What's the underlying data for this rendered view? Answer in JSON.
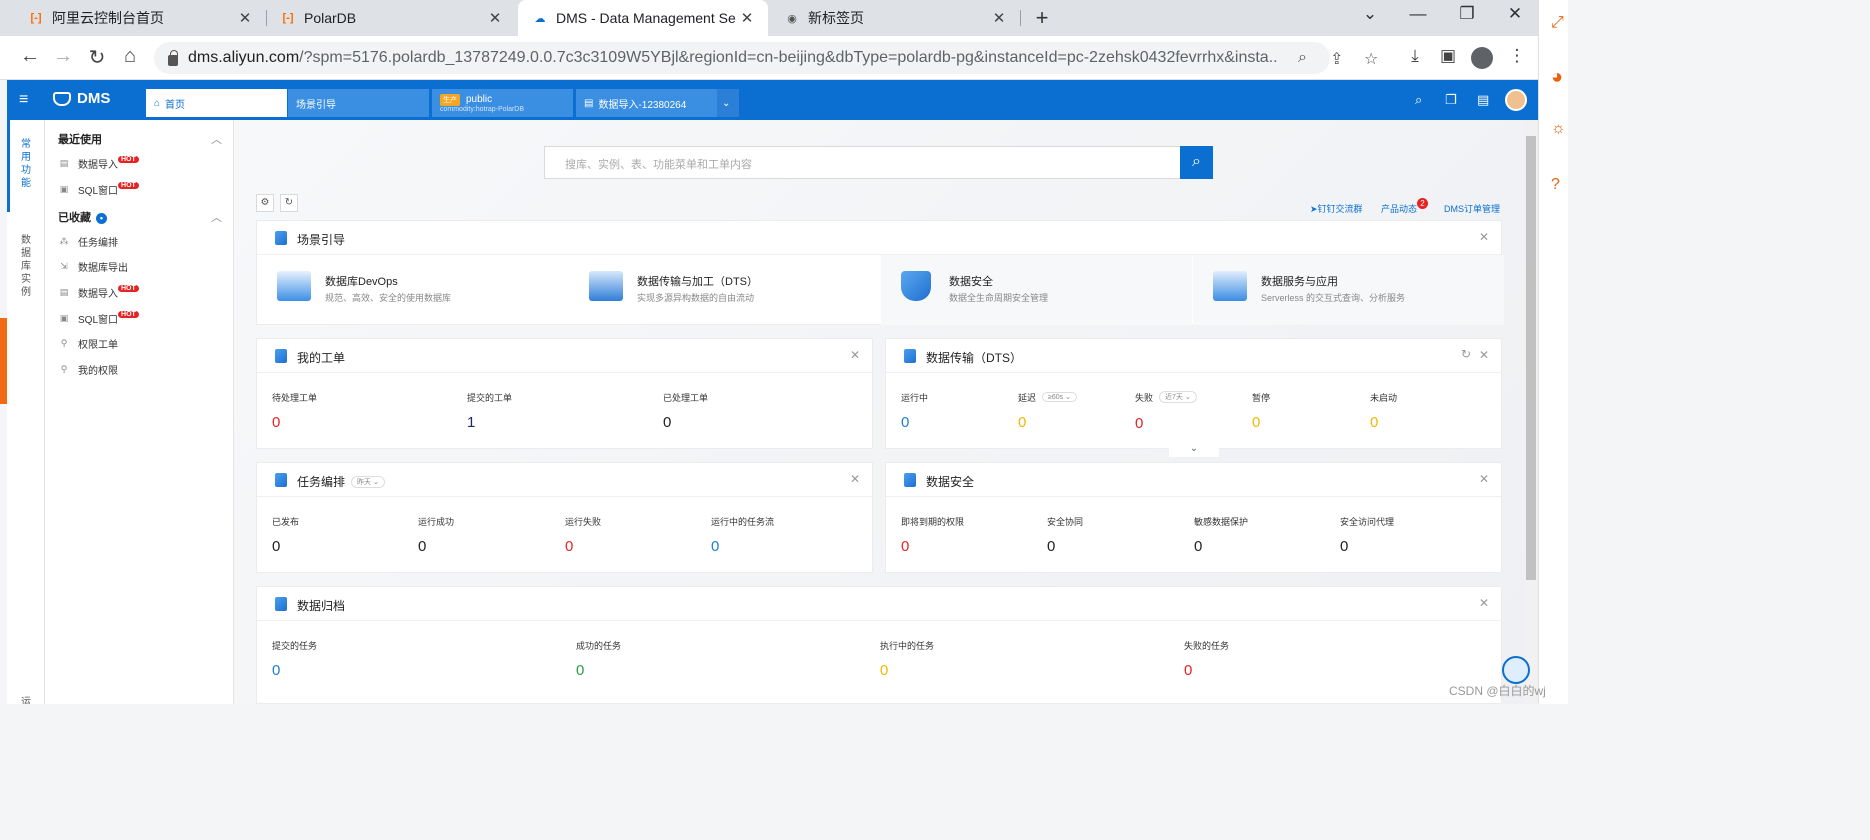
{
  "browser": {
    "tabs": [
      {
        "title": "阿里云控制台首页",
        "icon": "aliyun-icon"
      },
      {
        "title": "PolarDB",
        "icon": "aliyun-icon"
      },
      {
        "title": "DMS - Data Management Ser",
        "icon": "dms-icon",
        "active": true
      },
      {
        "title": "新标签页",
        "icon": "chrome-icon"
      }
    ],
    "url_domain": "dms.aliyun.com",
    "url_rest": "/?spm=5176.polardb_13787249.0.0.7c3c3109W5YBjl&regionId=cn-beijing&dbType=polardb-pg&instanceId=pc-2zehsk0432fevrrhx&insta..."
  },
  "dms": {
    "brand": "DMS",
    "tabs": [
      {
        "label": "首页"
      },
      {
        "label": "场景引导"
      },
      {
        "label": "public",
        "sub": "commodity:hotrap-PolarDB",
        "env": "生产"
      },
      {
        "label": "数据导入-12380264"
      }
    ]
  },
  "rail": {
    "items": [
      "常用功能",
      "数据库实例",
      "运"
    ]
  },
  "menu": {
    "recent_title": "最近使用",
    "recent": [
      {
        "label": "数据导入",
        "hot": "HOT"
      },
      {
        "label": "SQL窗口",
        "hot": "HOT"
      }
    ],
    "fav_title": "已收藏",
    "fav": [
      {
        "label": "任务编排"
      },
      {
        "label": "数据库导出"
      },
      {
        "label": "数据导入",
        "hot": "HOT"
      },
      {
        "label": "SQL窗口",
        "hot": "HOT"
      },
      {
        "label": "权限工单"
      },
      {
        "label": "我的权限"
      }
    ]
  },
  "main": {
    "search_placeholder": "搜库、实例、表、功能菜单和工单内容",
    "links": {
      "dingding": "钉钉交流群",
      "product": "产品动态",
      "product_badge": "2",
      "orders": "DMS订单管理"
    },
    "scenario": {
      "title": "场景引导",
      "items": [
        {
          "title": "数据库DevOps",
          "desc": "规范、高效、安全的使用数据库"
        },
        {
          "title": "数据传输与加工（DTS）",
          "desc": "实现多源异构数据的自由流动"
        },
        {
          "title": "数据安全",
          "desc": "数据全生命周期安全管理"
        },
        {
          "title": "数据服务与应用",
          "desc": "Serverless 的交互式查询、分析服务"
        }
      ]
    },
    "my_orders": {
      "title": "我的工单",
      "stats": [
        {
          "label": "待处理工单",
          "value": "0"
        },
        {
          "label": "提交的工单",
          "value": "1"
        },
        {
          "label": "已处理工单",
          "value": "0"
        }
      ]
    },
    "dts": {
      "title": "数据传输（DTS）",
      "stats": [
        {
          "label": "运行中",
          "value": "0"
        },
        {
          "label": "延迟",
          "value": "0",
          "select": "≥60s"
        },
        {
          "label": "失败",
          "value": "0",
          "select": "近7天"
        },
        {
          "label": "暂停",
          "value": "0"
        },
        {
          "label": "未启动",
          "value": "0"
        }
      ]
    },
    "tasks": {
      "title": "任务编排",
      "select": "昨天",
      "stats": [
        {
          "label": "已发布",
          "value": "0"
        },
        {
          "label": "运行成功",
          "value": "0"
        },
        {
          "label": "运行失败",
          "value": "0"
        },
        {
          "label": "运行中的任务流",
          "value": "0"
        }
      ]
    },
    "security": {
      "title": "数据安全",
      "stats": [
        {
          "label": "即将到期的权限",
          "value": "0"
        },
        {
          "label": "安全协同",
          "value": "0"
        },
        {
          "label": "敏感数据保护",
          "value": "0"
        },
        {
          "label": "安全访问代理",
          "value": "0"
        }
      ]
    },
    "archive": {
      "title": "数据归档",
      "stats": [
        {
          "label": "提交的任务",
          "value": "0"
        },
        {
          "label": "成功的任务",
          "value": "0"
        },
        {
          "label": "执行中的任务",
          "value": "0"
        },
        {
          "label": "失败的任务",
          "value": "0"
        }
      ]
    }
  },
  "colors": {
    "brand": "#0b6fd1",
    "red": "#e62222",
    "green": "#2e9d4a",
    "yellow": "#f5b800",
    "blue": "#1a7fd6"
  },
  "watermark": "CSDN @白白的wj"
}
